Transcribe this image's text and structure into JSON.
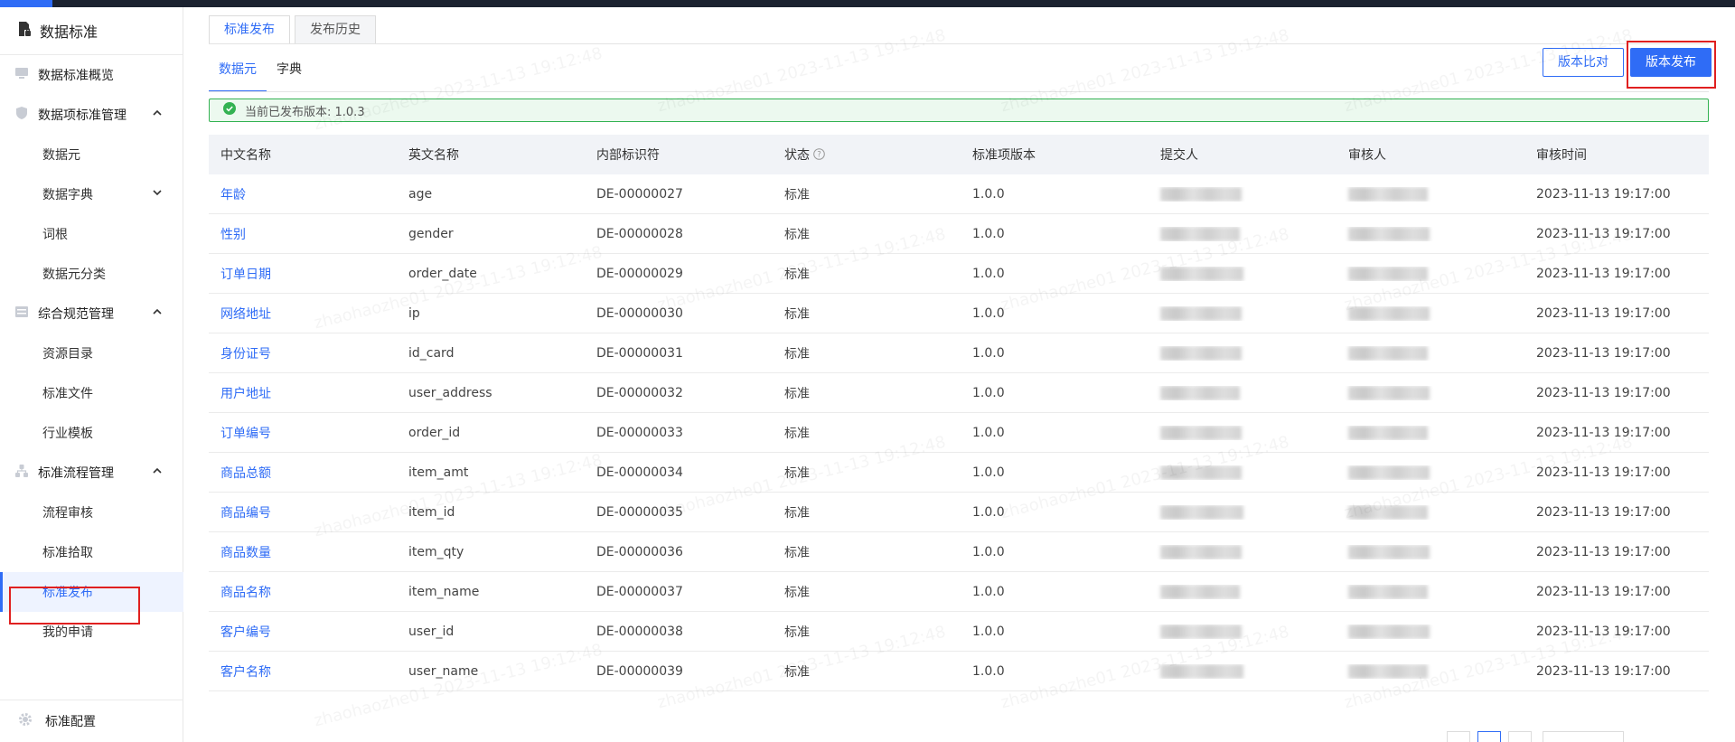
{
  "app": {
    "title": "数据标准"
  },
  "sidebar": {
    "overview": "数据标准概览",
    "groups": [
      {
        "label": "数据项标准管理",
        "items": [
          "数据元",
          "数据字典",
          "词根",
          "数据元分类"
        ]
      },
      {
        "label": "综合规范管理",
        "items": [
          "资源目录",
          "标准文件",
          "行业模板"
        ]
      },
      {
        "label": "标准流程管理",
        "items": [
          "流程审核",
          "标准拾取",
          "标准发布",
          "我的申请"
        ]
      }
    ],
    "active_item": "标准发布",
    "footer": "标准配置"
  },
  "tabs": [
    {
      "label": "标准发布",
      "active": true
    },
    {
      "label": "发布历史",
      "active": false
    }
  ],
  "sub_tabs": [
    {
      "label": "数据元",
      "active": true
    },
    {
      "label": "字典",
      "active": false
    }
  ],
  "toolbar": {
    "compare_label": "版本比对",
    "publish_label": "版本发布"
  },
  "alert": {
    "text": "当前已发布版本: 1.0.3"
  },
  "table": {
    "columns": [
      "中文名称",
      "英文名称",
      "内部标识符",
      "状态",
      "标准项版本",
      "提交人",
      "审核人",
      "审核时间"
    ],
    "rows": [
      {
        "cn": "年龄",
        "en": "age",
        "id": "DE-00000027",
        "status": "标准",
        "version": "1.0.0",
        "time": "2023-11-13 19:17:00"
      },
      {
        "cn": "性别",
        "en": "gender",
        "id": "DE-00000028",
        "status": "标准",
        "version": "1.0.0",
        "time": "2023-11-13 19:17:00"
      },
      {
        "cn": "订单日期",
        "en": "order_date",
        "id": "DE-00000029",
        "status": "标准",
        "version": "1.0.0",
        "time": "2023-11-13 19:17:00"
      },
      {
        "cn": "网络地址",
        "en": "ip",
        "id": "DE-00000030",
        "status": "标准",
        "version": "1.0.0",
        "time": "2023-11-13 19:17:00"
      },
      {
        "cn": "身份证号",
        "en": "id_card",
        "id": "DE-00000031",
        "status": "标准",
        "version": "1.0.0",
        "time": "2023-11-13 19:17:00"
      },
      {
        "cn": "用户地址",
        "en": "user_address",
        "id": "DE-00000032",
        "status": "标准",
        "version": "1.0.0",
        "time": "2023-11-13 19:17:00"
      },
      {
        "cn": "订单编号",
        "en": "order_id",
        "id": "DE-00000033",
        "status": "标准",
        "version": "1.0.0",
        "time": "2023-11-13 19:17:00"
      },
      {
        "cn": "商品总额",
        "en": "item_amt",
        "id": "DE-00000034",
        "status": "标准",
        "version": "1.0.0",
        "time": "2023-11-13 19:17:00"
      },
      {
        "cn": "商品编号",
        "en": "item_id",
        "id": "DE-00000035",
        "status": "标准",
        "version": "1.0.0",
        "time": "2023-11-13 19:17:00"
      },
      {
        "cn": "商品数量",
        "en": "item_qty",
        "id": "DE-00000036",
        "status": "标准",
        "version": "1.0.0",
        "time": "2023-11-13 19:17:00"
      },
      {
        "cn": "商品名称",
        "en": "item_name",
        "id": "DE-00000037",
        "status": "标准",
        "version": "1.0.0",
        "time": "2023-11-13 19:17:00"
      },
      {
        "cn": "客户编号",
        "en": "user_id",
        "id": "DE-00000038",
        "status": "标准",
        "version": "1.0.0",
        "time": "2023-11-13 19:17:00"
      },
      {
        "cn": "客户名称",
        "en": "user_name",
        "id": "DE-00000039",
        "status": "标准",
        "version": "1.0.0",
        "time": "2023-11-13 19:17:00"
      }
    ]
  },
  "watermark": "zhaohaozhe01 2023-11-13 19:12:48",
  "colors": {
    "primary": "#2f6cf6",
    "success": "#33b252",
    "highlight": "#e02020"
  },
  "icons": {
    "app": "document-lock-icon",
    "overview": "monitor-icon",
    "group1": "shield-icon",
    "group2": "list-icon",
    "group3": "flow-icon",
    "footer": "gear-icon",
    "alert": "check-circle-icon",
    "status_help": "question-circle-icon"
  }
}
